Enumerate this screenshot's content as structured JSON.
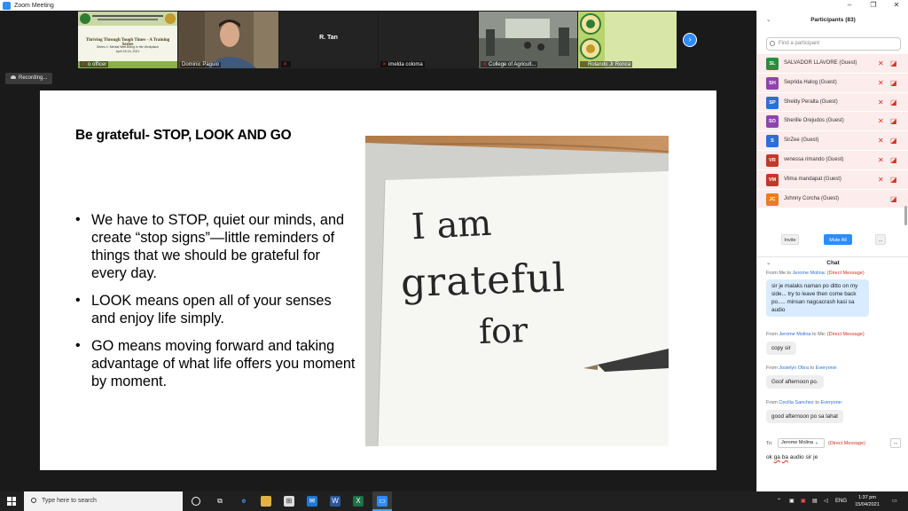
{
  "window": {
    "title": "Zoom Meeting"
  },
  "video_strip": {
    "tiles": [
      {
        "name": "o officer",
        "muted": true,
        "banner_text": "Thriving Through Tough Times - A Training Series",
        "banner_sub": "Series 1: Mental Well-Being in the Workplace",
        "banner_date": "April 15-16, 2021"
      },
      {
        "name": "Dominic Paguio",
        "muted": false
      },
      {
        "name": "R. Tan",
        "muted": true,
        "label": "R. Tan"
      },
      {
        "name": "imelda coloma",
        "muted": true
      },
      {
        "name": "College of Agricult...",
        "muted": true
      },
      {
        "name": "Rolando Jr Ronca",
        "muted": true
      }
    ],
    "next_icon": "chevron-right-icon"
  },
  "recording": {
    "label": "Recording..."
  },
  "slide": {
    "title": "Be grateful- STOP, LOOK AND GO",
    "bullets": [
      "We have to STOP, quiet our minds, and create “stop signs”—little reminders of things that we should be grateful for every day.",
      " LOOK means open all of your senses and enjoy life simply.",
      "GO means moving forward and taking advantage of what life offers you moment by moment."
    ],
    "photo_text": [
      "I am",
      "grateful",
      "for"
    ]
  },
  "participants": {
    "header": "Participants (83)",
    "search_placeholder": "Find a participant",
    "list": [
      {
        "initials": "SL",
        "name": "SALVADOR LLAVORE (Guest)",
        "color": "#2e8b3e"
      },
      {
        "initials": "SH",
        "name": "Seprida Halog (Guest)",
        "color": "#8e44ad"
      },
      {
        "initials": "SP",
        "name": "Sheldy Peralta (Guest)",
        "color": "#2d6fd6"
      },
      {
        "initials": "SO",
        "name": "Sherille Orejudos (Guest)",
        "color": "#8e44ad"
      },
      {
        "initials": "S",
        "name": "SirZee (Guest)",
        "color": "#2d6fd6"
      },
      {
        "initials": "VR",
        "name": "venessa rimando (Guest)",
        "color": "#c0392b"
      },
      {
        "initials": "VM",
        "name": "Vilma mandapat (Guest)",
        "color": "#c0392b"
      },
      {
        "initials": "JC",
        "name": "Johnny Corcha (Guest)",
        "color": "#e67e22"
      }
    ],
    "invite_label": "Invite",
    "mute_all_label": "Mute All",
    "more_label": "..."
  },
  "chat": {
    "header": "Chat",
    "messages": [
      {
        "from_prefix": "From ",
        "from": "Me",
        "to_prefix": " to ",
        "to": "Jerome Molina",
        "suffix": ": (Direct Message)",
        "text": "sir je malaks naman po ditto on my side... try to leave then come back po..... minsan nagcacrash kasi sa audio"
      },
      {
        "from_prefix": "From ",
        "from": "Jerome Molina",
        "to_prefix": " to ",
        "to": "Me",
        "suffix": ": (Direct Message)",
        "text": "copy sir"
      },
      {
        "from_prefix": "From ",
        "from": "Josielyn Obra",
        "to_prefix": " to ",
        "to": "Everyone",
        "suffix": ":",
        "text": "Goof afternoon po."
      },
      {
        "from_prefix": "From ",
        "from": "Cecilia Sanchez",
        "to_prefix": " to ",
        "to": "Everyone",
        "suffix": ":",
        "text": "good afternoon po sa lahat"
      }
    ],
    "to_label": "To:",
    "to_value": "Jerome Molina",
    "to_dm": "(Direct Message)",
    "more_label": "...",
    "input_parts": [
      "ok ",
      "ga",
      " ",
      "ba",
      " audio sir je"
    ]
  },
  "taskbar": {
    "search_placeholder": "Type here to search",
    "lang": "ENG",
    "time": "1:37 pm",
    "date": "15/04/2021"
  }
}
